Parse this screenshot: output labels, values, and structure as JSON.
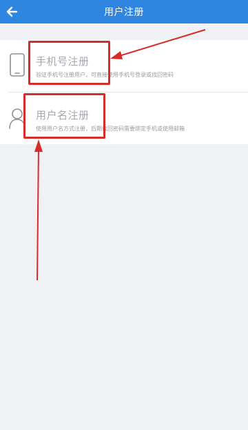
{
  "header": {
    "title": "用户注册",
    "back_icon": "back-arrow-icon",
    "background": "#2f86e0"
  },
  "options": [
    {
      "icon": "phone-icon",
      "title": "手机号注册",
      "description": "验证手机号注册用户，可直接使用手机号登录或找回密码"
    },
    {
      "icon": "user-icon",
      "title": "用户名注册",
      "description": "使用用户名方式注册，后期找回密码需要绑定手机或使用邮箱"
    }
  ],
  "annotations": {
    "color": "#d62c2a"
  }
}
